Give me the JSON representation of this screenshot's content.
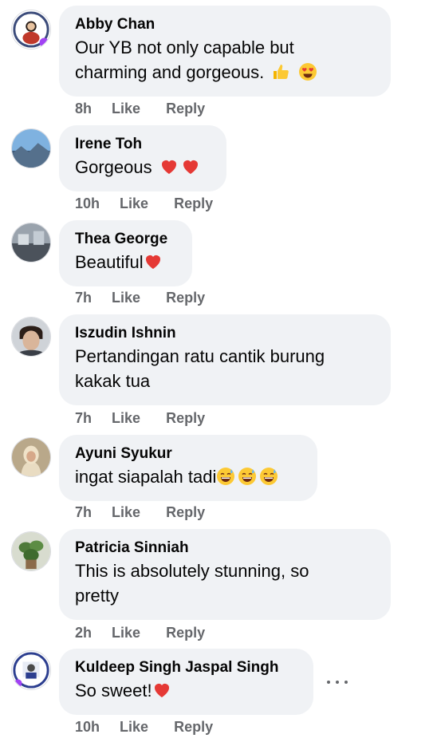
{
  "comments": [
    {
      "author": "Abby Chan",
      "text_lines": [
        "Our YB not only capable but",
        "charming and gorgeous."
      ],
      "emojis": [
        "thumbs-up",
        "heart-eyes"
      ],
      "time": "8h",
      "like": "Like",
      "reply": "Reply",
      "avatar": "avatar-abby-chan"
    },
    {
      "author": "Irene Toh",
      "text_lines": [
        "Gorgeous"
      ],
      "emojis": [
        "red-heart",
        "red-heart"
      ],
      "time": "10h",
      "like": "Like",
      "reply": "Reply",
      "avatar": "avatar-irene-toh"
    },
    {
      "author": "Thea George",
      "text_lines": [
        "Beautiful"
      ],
      "emojis": [
        "red-heart"
      ],
      "time": "7h",
      "like": "Like",
      "reply": "Reply",
      "avatar": "avatar-thea-george"
    },
    {
      "author": "Iszudin Ishnin",
      "text_lines": [
        "Pertandingan ratu cantik burung",
        "kakak tua"
      ],
      "emojis": [],
      "time": "7h",
      "like": "Like",
      "reply": "Reply",
      "avatar": "avatar-iszudin-ishnin"
    },
    {
      "author": "Ayuni Syukur",
      "text_lines": [
        "ingat siapalah tadi"
      ],
      "emojis": [
        "grinning-sweat",
        "grinning-sweat",
        "grinning-sweat"
      ],
      "time": "7h",
      "like": "Like",
      "reply": "Reply",
      "avatar": "avatar-ayuni-syukur"
    },
    {
      "author": "Patricia Sinniah",
      "text_lines": [
        "This is absolutely stunning, so",
        "pretty"
      ],
      "emojis": [],
      "time": "2h",
      "like": "Like",
      "reply": "Reply",
      "avatar": "avatar-patricia-sinniah"
    },
    {
      "author": "Kuldeep Singh Jaspal Singh",
      "text_lines": [
        "So sweet!"
      ],
      "emojis": [
        "red-heart"
      ],
      "time": "10h",
      "like": "Like",
      "reply": "Reply",
      "avatar": "avatar-kuldeep-singh",
      "has_more_menu": true
    }
  ],
  "colors": {
    "bubble": "#f0f2f5",
    "text": "#050505",
    "meta": "#65676b"
  }
}
